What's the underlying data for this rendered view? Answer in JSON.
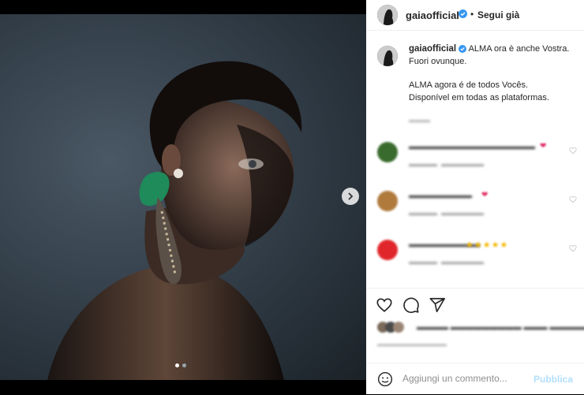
{
  "post": {
    "username": "gaiaofficial",
    "follow_separator": "•",
    "follow_label": "Segui già",
    "slide_count": 2,
    "active_slide": 1
  },
  "caption": {
    "username": "gaiaofficial",
    "line1_rest": "ALMA ora è anche Vostra.",
    "line2": "Fuori ovunque.",
    "line3": "ALMA agora é de todos Vocês.",
    "line4": "Disponível em todas as plataformas."
  },
  "comments": [
    {
      "avatar_color": "#3a6b2e",
      "heart": true,
      "stars": false
    },
    {
      "avatar_color": "#b07a3c",
      "heart": true,
      "stars": false
    },
    {
      "avatar_color": "#e0262b",
      "heart": false,
      "stars": true
    }
  ],
  "add_comment": {
    "placeholder": "Aggiungi un commento...",
    "publish_label": "Pubblica"
  },
  "icons": {
    "verified": "verified-badge-icon",
    "next": "chevron-right-icon",
    "like": "heart-icon",
    "comment": "comment-icon",
    "share": "paper-plane-icon",
    "emoji": "emoji-smile-icon"
  },
  "colors": {
    "verified": "#3897f0",
    "heart": "#e0245e",
    "publish": "#b2dffc"
  }
}
